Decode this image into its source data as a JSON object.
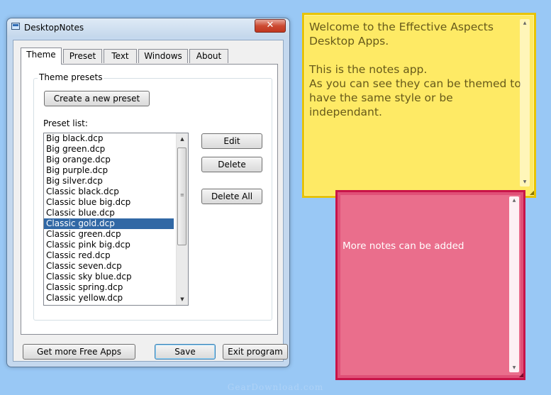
{
  "window": {
    "title": "DesktopNotes",
    "close_label": "✕"
  },
  "tabs": [
    {
      "label": "Theme",
      "active": true
    },
    {
      "label": "Preset",
      "active": false
    },
    {
      "label": "Text",
      "active": false
    },
    {
      "label": "Windows",
      "active": false
    },
    {
      "label": "About",
      "active": false
    }
  ],
  "theme_panel": {
    "group_title": "Theme presets",
    "create_button": "Create a new preset",
    "list_label": "Preset list:",
    "presets": [
      "Big black.dcp",
      "Big green.dcp",
      "Big orange.dcp",
      "Big purple.dcp",
      "Big silver.dcp",
      "Classic black.dcp",
      "Classic blue big.dcp",
      "Classic blue.dcp",
      "Classic gold.dcp",
      "Classic green.dcp",
      "Classic pink big.dcp",
      "Classic red.dcp",
      "Classic seven.dcp",
      "Classic sky blue.dcp",
      "Classic spring.dcp",
      "Classic yellow.dcp"
    ],
    "selected": "Classic gold.dcp",
    "edit_button": "Edit",
    "delete_button": "Delete",
    "delete_all_button": "Delete All"
  },
  "footer": {
    "get_more_button": "Get more Free Apps",
    "save_button": "Save",
    "exit_button": "Exit program"
  },
  "notes": {
    "yellow_text": "Welcome to the Effective Aspects Desktop Apps.\n\nThis is the notes app.\nAs you can see they can be themed to have the same style or be independant.",
    "pink_text": "More notes can be added"
  },
  "watermark": "GearDownload.com",
  "colors": {
    "desktop": "#99c8f5",
    "note_yellow": "#feea65",
    "note_pink": "#ea6e8c",
    "selection": "#3168a5"
  }
}
